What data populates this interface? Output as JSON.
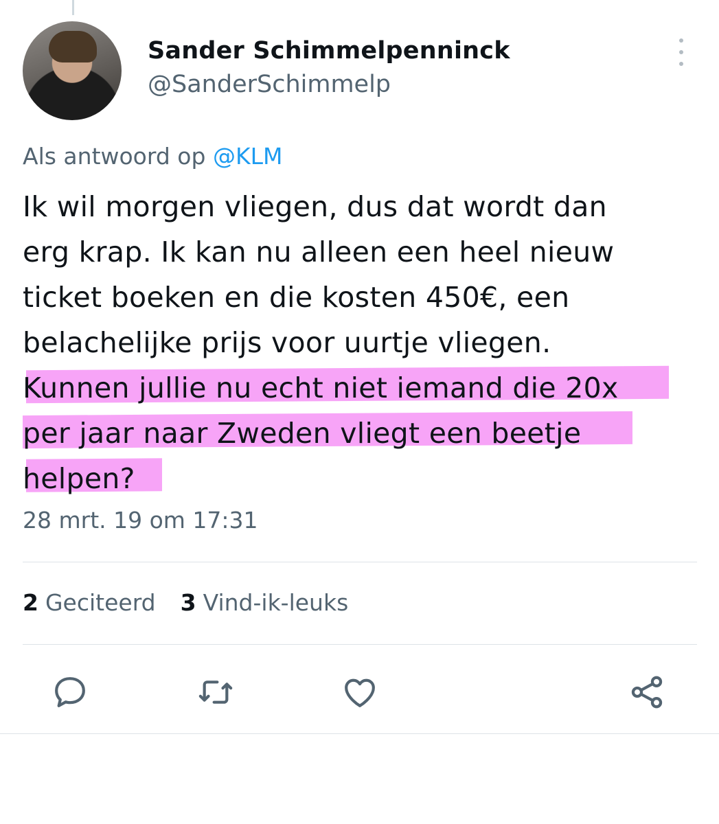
{
  "user": {
    "name": "Sander Schimmelpenninck",
    "handle": "@SanderSchimmelp"
  },
  "reply": {
    "prefix": "Als antwoord op ",
    "mention": "@KLM"
  },
  "tweet": {
    "text_lines": [
      "Ik wil morgen vliegen, dus dat wordt dan",
      "erg krap. Ik kan nu alleen een heel nieuw",
      "ticket boeken en die kosten 450€, een",
      "belachelijke prijs voor uurtje vliegen.",
      "Kunnen jullie nu echt niet iemand die 20x",
      "per jaar naar Zweden vliegt een beetje",
      "helpen?"
    ],
    "highlight_color": "#f05af0",
    "timestamp": "28 mrt. 19 om 17:31"
  },
  "stats": {
    "quotes_count": "2",
    "quotes_label": "Geciteerd",
    "likes_count": "3",
    "likes_label": "Vind-ik-leuks"
  },
  "actions": [
    "reply-icon",
    "retweet-icon",
    "like-icon",
    "share-icon"
  ],
  "colors": {
    "text": "#0f1419",
    "secondary": "#536471",
    "link": "#1d9bf0",
    "icon": "#536471"
  }
}
